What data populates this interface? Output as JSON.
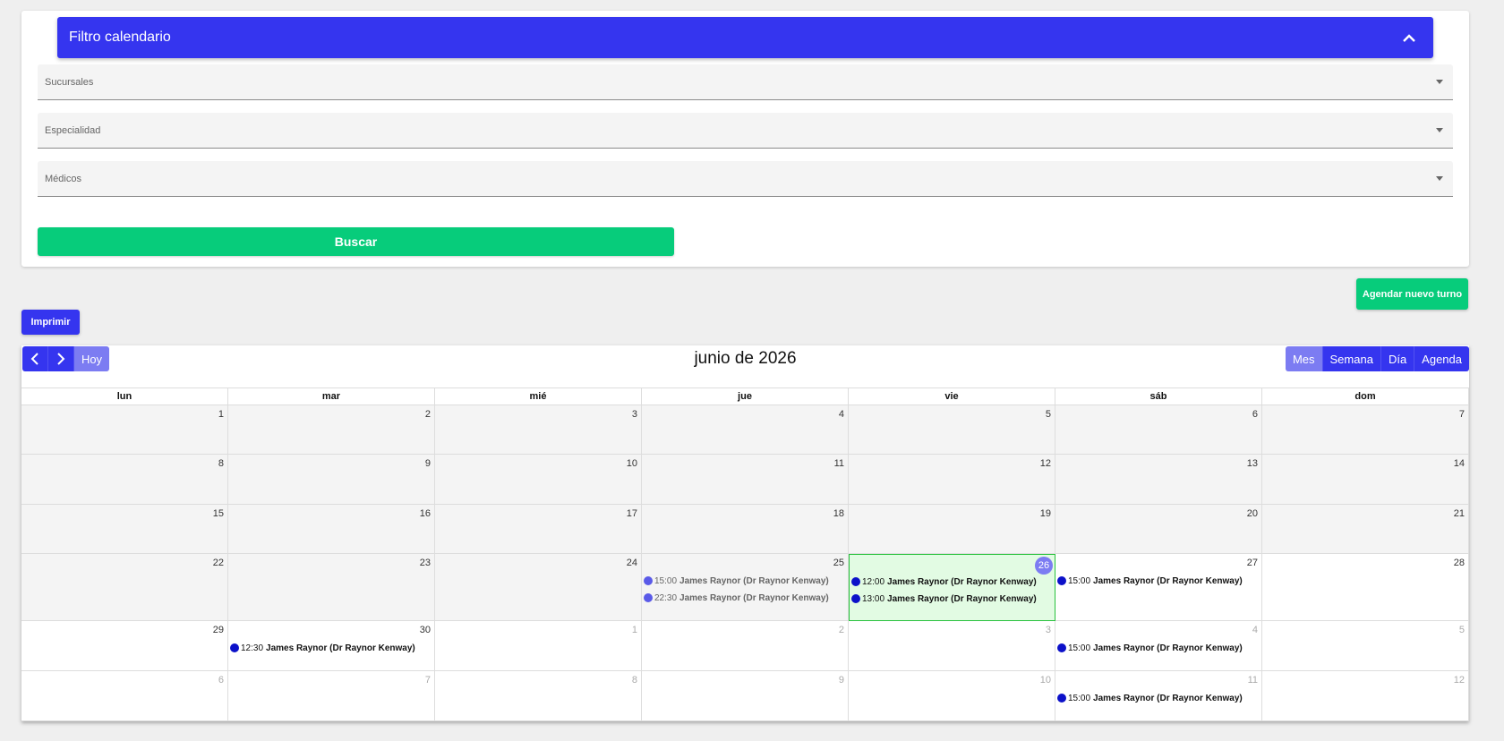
{
  "filter": {
    "title": "Filtro calendario",
    "fields": [
      {
        "label": "Sucursales",
        "value": ""
      },
      {
        "label": "Especialidad",
        "value": ""
      },
      {
        "label": "Médicos",
        "value": ""
      }
    ],
    "search_label": "Buscar"
  },
  "actions": {
    "new_appointment_label": "Agendar nuevo turno",
    "print_label": "Imprimir"
  },
  "calendar": {
    "title": "junio de 2026",
    "today_label": "Hoy",
    "views": [
      "Mes",
      "Semana",
      "Día",
      "Agenda"
    ],
    "active_view": "Mes",
    "weekdays": [
      "lun",
      "mar",
      "mié",
      "jue",
      "vie",
      "sáb",
      "dom"
    ],
    "weeks": [
      [
        {
          "day": "1",
          "type": "past",
          "events": []
        },
        {
          "day": "2",
          "type": "past",
          "events": []
        },
        {
          "day": "3",
          "type": "past",
          "events": []
        },
        {
          "day": "4",
          "type": "past",
          "events": []
        },
        {
          "day": "5",
          "type": "past",
          "events": []
        },
        {
          "day": "6",
          "type": "past",
          "events": []
        },
        {
          "day": "7",
          "type": "past",
          "events": []
        }
      ],
      [
        {
          "day": "8",
          "type": "past",
          "events": []
        },
        {
          "day": "9",
          "type": "past",
          "events": []
        },
        {
          "day": "10",
          "type": "past",
          "events": []
        },
        {
          "day": "11",
          "type": "past",
          "events": []
        },
        {
          "day": "12",
          "type": "past",
          "events": []
        },
        {
          "day": "13",
          "type": "past",
          "events": []
        },
        {
          "day": "14",
          "type": "past",
          "events": []
        }
      ],
      [
        {
          "day": "15",
          "type": "past",
          "events": []
        },
        {
          "day": "16",
          "type": "past",
          "events": []
        },
        {
          "day": "17",
          "type": "past",
          "events": []
        },
        {
          "day": "18",
          "type": "past",
          "events": []
        },
        {
          "day": "19",
          "type": "past",
          "events": []
        },
        {
          "day": "20",
          "type": "past",
          "events": []
        },
        {
          "day": "21",
          "type": "past",
          "events": []
        }
      ],
      [
        {
          "day": "22",
          "type": "past",
          "events": []
        },
        {
          "day": "23",
          "type": "past",
          "events": []
        },
        {
          "day": "24",
          "type": "past",
          "events": []
        },
        {
          "day": "25",
          "type": "past",
          "events": [
            {
              "time": "15:00",
              "name": "James Raynor (Dr Raynor Kenway)",
              "faded": true
            },
            {
              "time": "22:30",
              "name": "James Raynor (Dr Raynor Kenway)",
              "faded": true
            }
          ]
        },
        {
          "day": "26",
          "type": "today",
          "events": [
            {
              "time": "12:00",
              "name": "James Raynor (Dr Raynor Kenway)",
              "faded": false
            },
            {
              "time": "13:00",
              "name": "James Raynor (Dr Raynor Kenway)",
              "faded": false
            }
          ]
        },
        {
          "day": "27",
          "type": "current",
          "events": [
            {
              "time": "15:00",
              "name": "James Raynor (Dr Raynor Kenway)",
              "faded": false
            }
          ]
        },
        {
          "day": "28",
          "type": "current",
          "events": []
        }
      ],
      [
        {
          "day": "29",
          "type": "current",
          "events": []
        },
        {
          "day": "30",
          "type": "current",
          "events": [
            {
              "time": "12:30",
              "name": "James Raynor (Dr Raynor Kenway)",
              "faded": false
            }
          ]
        },
        {
          "day": "1",
          "type": "other",
          "events": []
        },
        {
          "day": "2",
          "type": "other",
          "events": []
        },
        {
          "day": "3",
          "type": "other",
          "events": []
        },
        {
          "day": "4",
          "type": "other",
          "events": [
            {
              "time": "15:00",
              "name": "James Raynor (Dr Raynor Kenway)",
              "faded": false
            }
          ]
        },
        {
          "day": "5",
          "type": "other",
          "events": []
        }
      ],
      [
        {
          "day": "6",
          "type": "other",
          "events": []
        },
        {
          "day": "7",
          "type": "other",
          "events": []
        },
        {
          "day": "8",
          "type": "other",
          "events": []
        },
        {
          "day": "9",
          "type": "other",
          "events": []
        },
        {
          "day": "10",
          "type": "other",
          "events": []
        },
        {
          "day": "11",
          "type": "other",
          "events": [
            {
              "time": "15:00",
              "name": "James Raynor (Dr Raynor Kenway)",
              "faded": false
            }
          ]
        },
        {
          "day": "12",
          "type": "other",
          "events": []
        }
      ]
    ]
  },
  "colors": {
    "primary": "#3535ef",
    "primary_light": "#7c7cf2",
    "success": "#07cc7b",
    "today_bg": "#e2fbe3",
    "today_border": "#29c23d",
    "event_dot": "#0c11c9"
  }
}
